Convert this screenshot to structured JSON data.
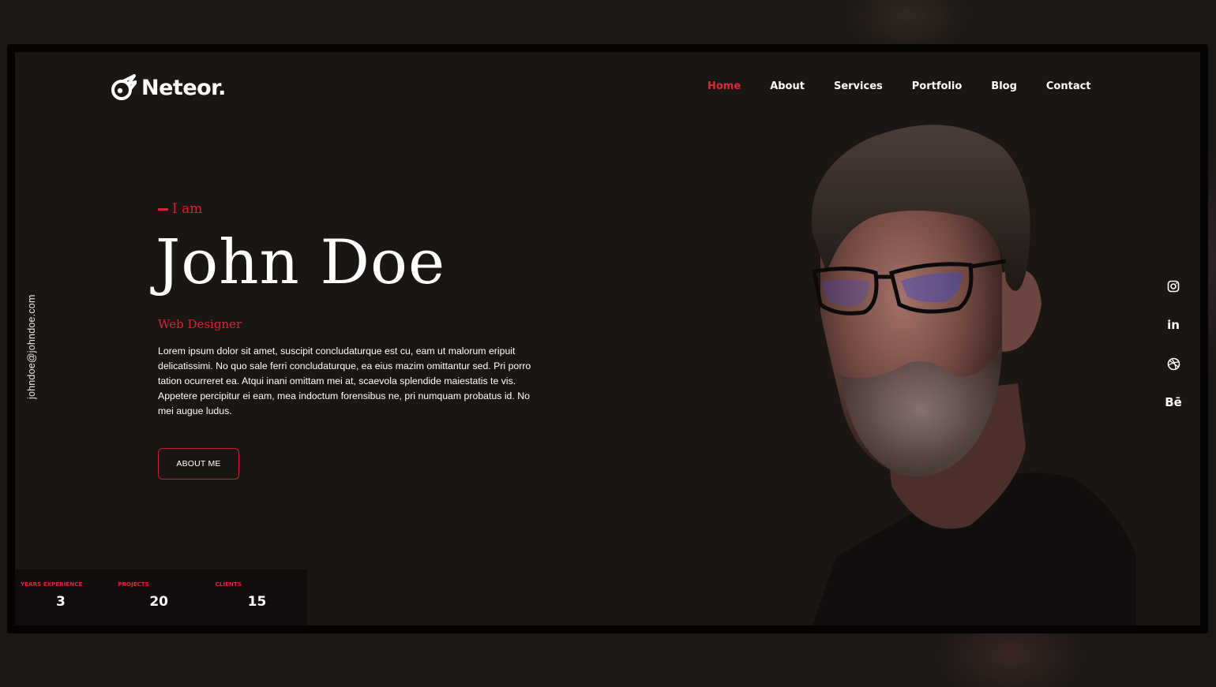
{
  "brand": {
    "name": "Neteor."
  },
  "nav": {
    "items": [
      {
        "label": "Home",
        "active": true
      },
      {
        "label": "About",
        "active": false
      },
      {
        "label": "Services",
        "active": false
      },
      {
        "label": "Portfolio",
        "active": false
      },
      {
        "label": "Blog",
        "active": false
      },
      {
        "label": "Contact",
        "active": false
      }
    ]
  },
  "contact": {
    "email": "johndoe@johndoe.com"
  },
  "hero": {
    "intro": "I am",
    "name": "John Doe",
    "role": "Web Designer",
    "bio": "Lorem ipsum dolor sit amet, suscipit concludaturque est cu, eam ut malorum eripuit delicatissimi. No quo sale ferri concludaturque, ea eius mazim omittantur sed. Pri porro tation ocurreret ea. Atqui inani omittam mei at, scaevola splendide maiestatis te vis. Appetere percipitur ei eam, mea indoctum forensibus ne, pri numquam probatus id. No mei augue ludus.",
    "cta_label": "ABOUT ME"
  },
  "stats": [
    {
      "label": "YEARS EXPERIENCE",
      "value": "3"
    },
    {
      "label": "PROJECTS",
      "value": "20"
    },
    {
      "label": "CLIENTS",
      "value": "15"
    }
  ],
  "social": [
    {
      "icon": "instagram-icon"
    },
    {
      "icon": "linkedin-icon",
      "text": "in"
    },
    {
      "icon": "dribbble-icon"
    },
    {
      "icon": "behance-icon",
      "text": "Bē"
    }
  ],
  "colors": {
    "accent": "#e0283e",
    "background": "#1a1614",
    "text": "#ffffff"
  }
}
